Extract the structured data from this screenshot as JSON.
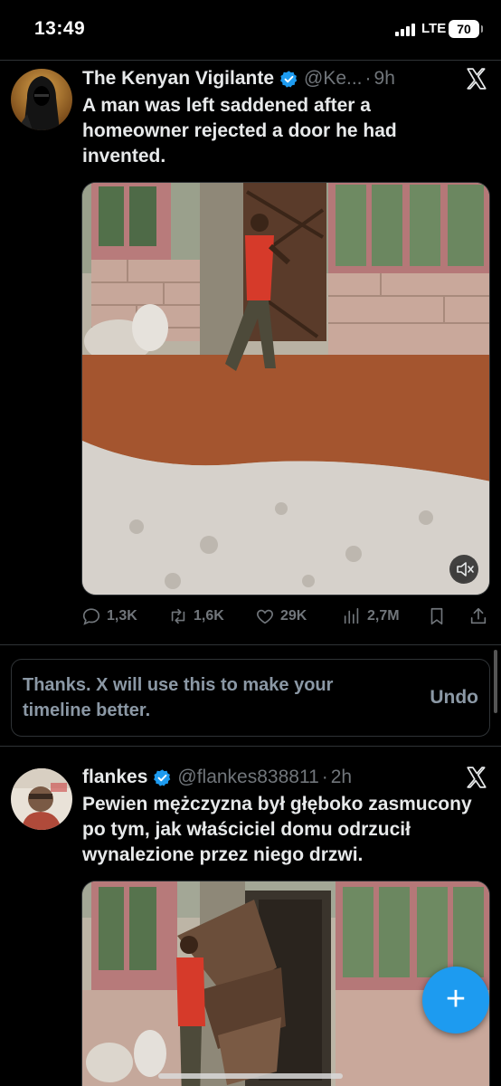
{
  "status_bar": {
    "time": "13:49",
    "network": "LTE",
    "battery": "70"
  },
  "tweets": [
    {
      "author_name": "The Kenyan Vigilante",
      "handle": "@Ke...",
      "time_separator": "·",
      "time_ago": "9h",
      "text": "A man was left saddened after a homeowner rejected a door he had invented.",
      "stats": {
        "replies": "1,3K",
        "retweets": "1,6K",
        "likes": "29K",
        "views": "2,7M"
      }
    },
    {
      "author_name": "flankes",
      "handle": "@flankes838811",
      "time_separator": "·",
      "time_ago": "2h",
      "text": "Pewien mężczyzna był głęboko zasmucony po tym, jak właściciel domu odrzucił wynalezione przez niego drzwi."
    }
  ],
  "feedback": {
    "message": "Thanks. X will use this to make your timeline better.",
    "undo_label": "Undo"
  },
  "fab": {
    "label": "+"
  },
  "colors": {
    "background": "#000000",
    "accent": "#1d9bf0",
    "muted": "#71767b",
    "divider": "#2f3336"
  },
  "icons": [
    "x-logo-icon",
    "verified-badge-icon",
    "reply-icon",
    "retweet-icon",
    "like-icon",
    "views-icon",
    "bookmark-icon",
    "share-icon",
    "mute-icon",
    "compose-icon"
  ]
}
